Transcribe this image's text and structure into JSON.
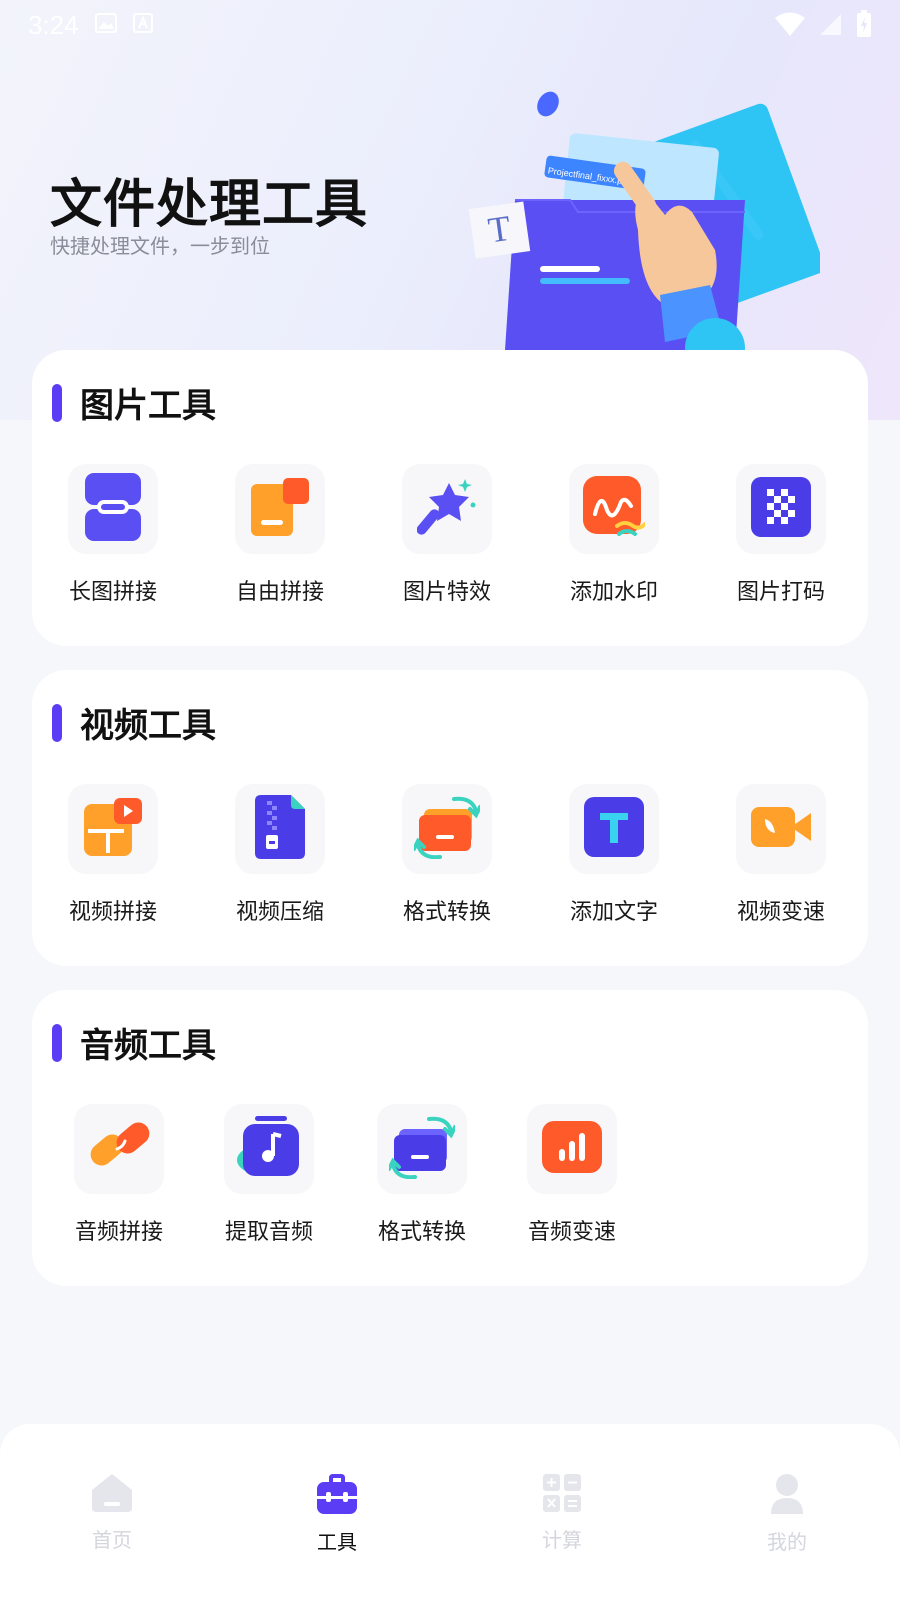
{
  "status": {
    "time": "3:24"
  },
  "hero": {
    "title": "文件处理工具",
    "subtitle": "快捷处理文件，一步到位",
    "art_filename": "Projectfinal_fixxx.psd",
    "art_letter": "T"
  },
  "sections": [
    {
      "title": "图片工具",
      "items": [
        {
          "label": "长图拼接",
          "icon": "long-image-stitch-icon"
        },
        {
          "label": "自由拼接",
          "icon": "free-collage-icon"
        },
        {
          "label": "图片特效",
          "icon": "magic-wand-icon"
        },
        {
          "label": "添加水印",
          "icon": "watermark-icon"
        },
        {
          "label": "图片打码",
          "icon": "mosaic-icon"
        }
      ]
    },
    {
      "title": "视频工具",
      "items": [
        {
          "label": "视频拼接",
          "icon": "video-stitch-icon"
        },
        {
          "label": "视频压缩",
          "icon": "video-compress-icon"
        },
        {
          "label": "格式转换",
          "icon": "video-convert-icon"
        },
        {
          "label": "添加文字",
          "icon": "add-text-icon"
        },
        {
          "label": "视频变速",
          "icon": "video-speed-icon"
        }
      ]
    },
    {
      "title": "音频工具",
      "items": [
        {
          "label": "音频拼接",
          "icon": "audio-stitch-icon"
        },
        {
          "label": "提取音频",
          "icon": "extract-audio-icon"
        },
        {
          "label": "格式转换",
          "icon": "audio-convert-icon"
        },
        {
          "label": "音频变速",
          "icon": "audio-speed-icon"
        }
      ]
    }
  ],
  "tabbar": [
    {
      "label": "首页",
      "icon": "home-icon",
      "active": false
    },
    {
      "label": "工具",
      "icon": "toolbox-icon",
      "active": true
    },
    {
      "label": "计算",
      "icon": "calculator-icon",
      "active": false
    },
    {
      "label": "我的",
      "icon": "profile-icon",
      "active": false
    }
  ],
  "colors": {
    "accent": "#5b3df5",
    "orange": "#ff7a2a",
    "inactive_tab": "#d4d6dd"
  }
}
